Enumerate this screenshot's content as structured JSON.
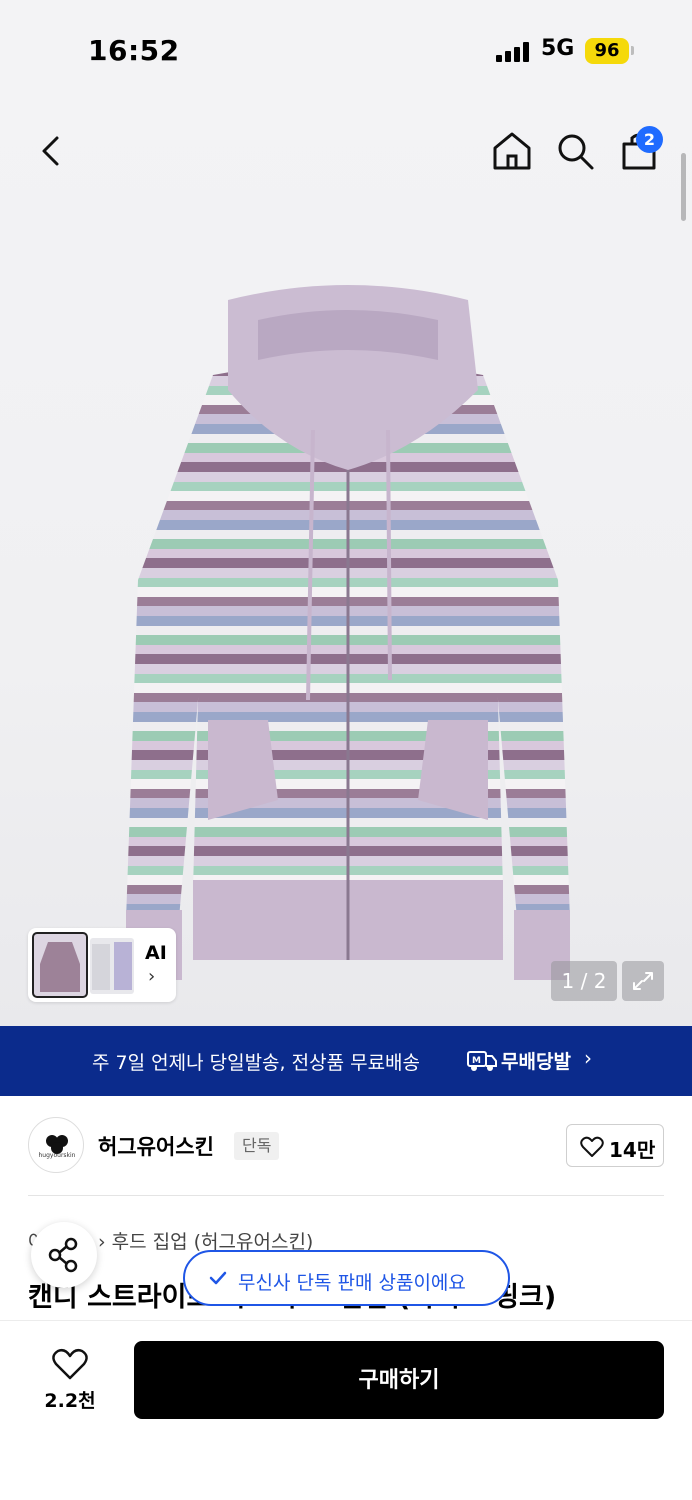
{
  "status_bar": {
    "time": "16:52",
    "network": "5G",
    "battery": "96"
  },
  "nav": {
    "cart_count": "2"
  },
  "gallery": {
    "page_indicator": "1 / 2",
    "ai_label": "AI"
  },
  "banner": {
    "text": "주 7일 언제나 당일발송, 전상품 무료배송",
    "logo_text": "무배당발"
  },
  "brand": {
    "name": "허그유어스킨",
    "tag": "단독",
    "likes": "14만",
    "logo_text": "hugyourskin"
  },
  "breadcrumb": {
    "prefix": "아우터",
    "category": "후드 집업 (허그유어스킨)"
  },
  "product": {
    "title": "캔디 스트라이프 니트 후드 집업 (라이트 핑크)"
  },
  "toast": {
    "text": "무신사 단독 판매 상품이에요"
  },
  "bottom_bar": {
    "wish_count": "2.2천",
    "buy_label": "구매하기"
  },
  "colors": {
    "banner_bg": "#0b2b8c",
    "accent_blue": "#1f56e6",
    "cart_badge": "#1f6bff",
    "battery": "#f5d90a"
  }
}
